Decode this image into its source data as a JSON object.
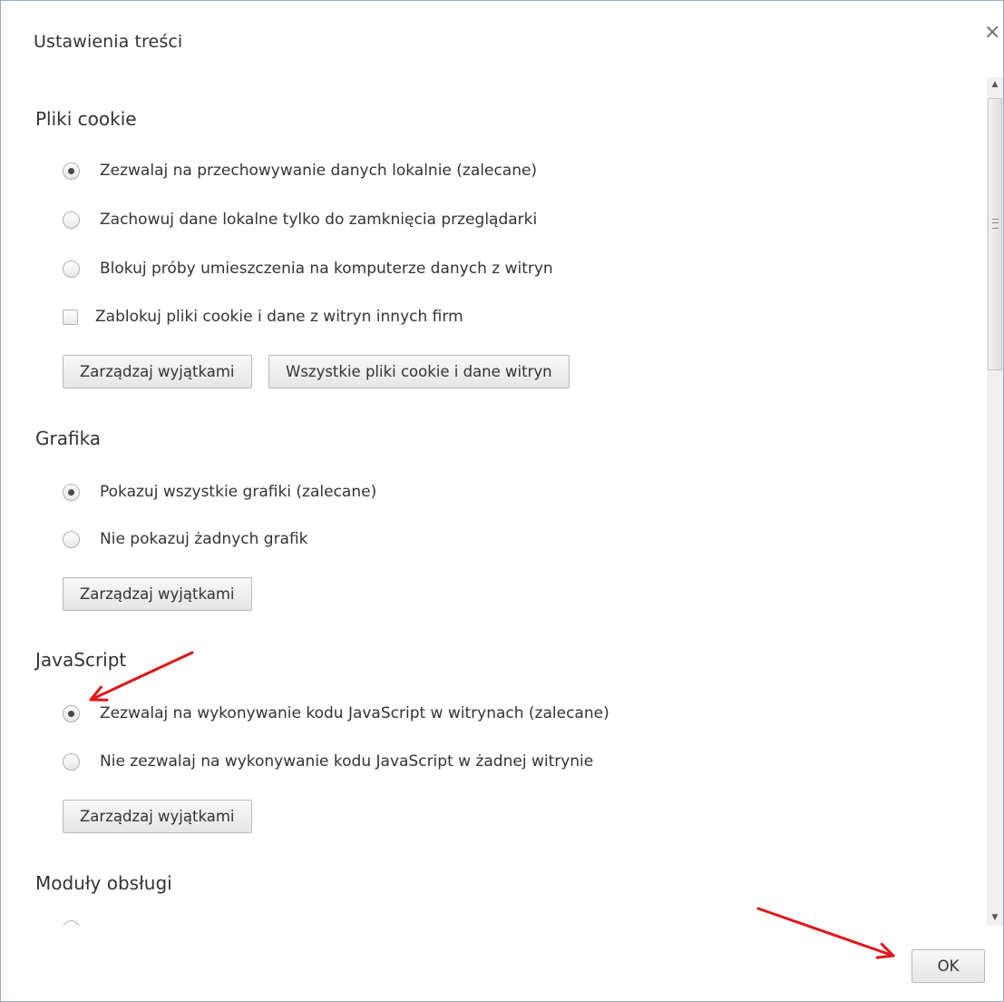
{
  "dialog": {
    "title": "Ustawienia treści",
    "close_label": "×",
    "ok_label": "OK"
  },
  "sections": {
    "cookies": {
      "title": "Pliki cookie",
      "options": [
        {
          "label": "Zezwalaj na przechowywanie danych lokalnie (zalecane)",
          "checked": true
        },
        {
          "label": "Zachowuj dane lokalne tylko do zamknięcia przeglądarki",
          "checked": false
        },
        {
          "label": "Blokuj próby umieszczenia na komputerze danych z witryn",
          "checked": false
        }
      ],
      "block_third_party_label": "Zablokuj pliki cookie i dane z witryn innych firm",
      "block_third_party_checked": false,
      "manage_exceptions_label": "Zarządzaj wyjątkami",
      "all_cookies_label": "Wszystkie pliki cookie i dane witryn"
    },
    "images": {
      "title": "Grafika",
      "options": [
        {
          "label": "Pokazuj wszystkie grafiki (zalecane)",
          "checked": true
        },
        {
          "label": "Nie pokazuj żadnych grafik",
          "checked": false
        }
      ],
      "manage_exceptions_label": "Zarządzaj wyjątkami"
    },
    "javascript": {
      "title": "JavaScript",
      "options": [
        {
          "label": "Zezwalaj na wykonywanie kodu JavaScript w witrynach (zalecane)",
          "checked": true
        },
        {
          "label": "Nie zezwalaj na wykonywanie kodu JavaScript w żadnej witrynie",
          "checked": false
        }
      ],
      "manage_exceptions_label": "Zarządzaj wyjątkami"
    },
    "plugins": {
      "title": "Moduły obsługi"
    }
  },
  "annotation_color": "#e0161a"
}
